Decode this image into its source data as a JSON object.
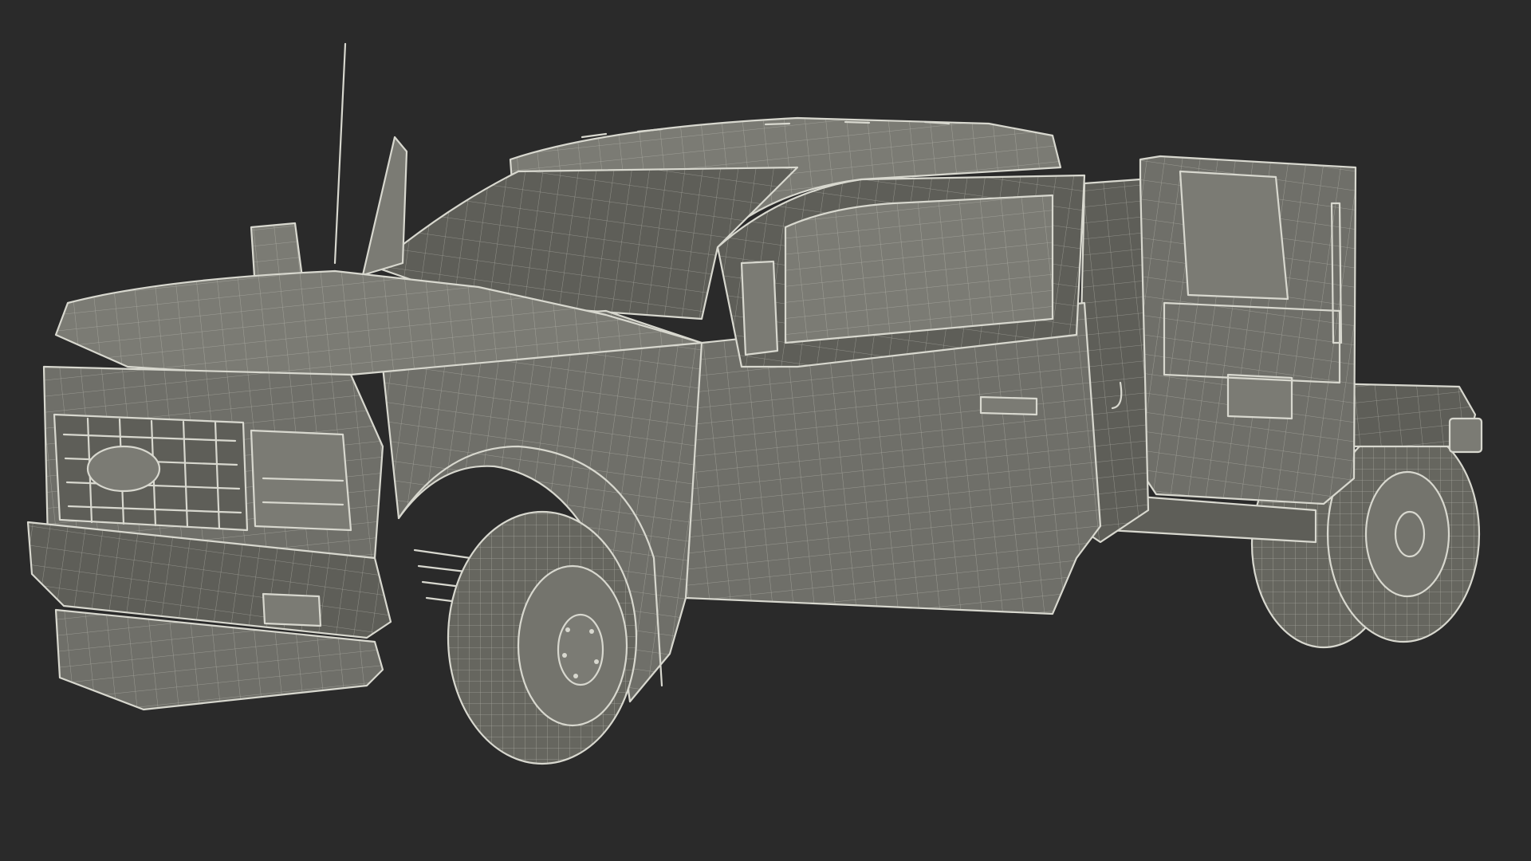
{
  "scene": {
    "background_color": "#2a2a2a",
    "model_fill_color": "#6f6f69",
    "wireframe_color": "#d8d8cf"
  }
}
